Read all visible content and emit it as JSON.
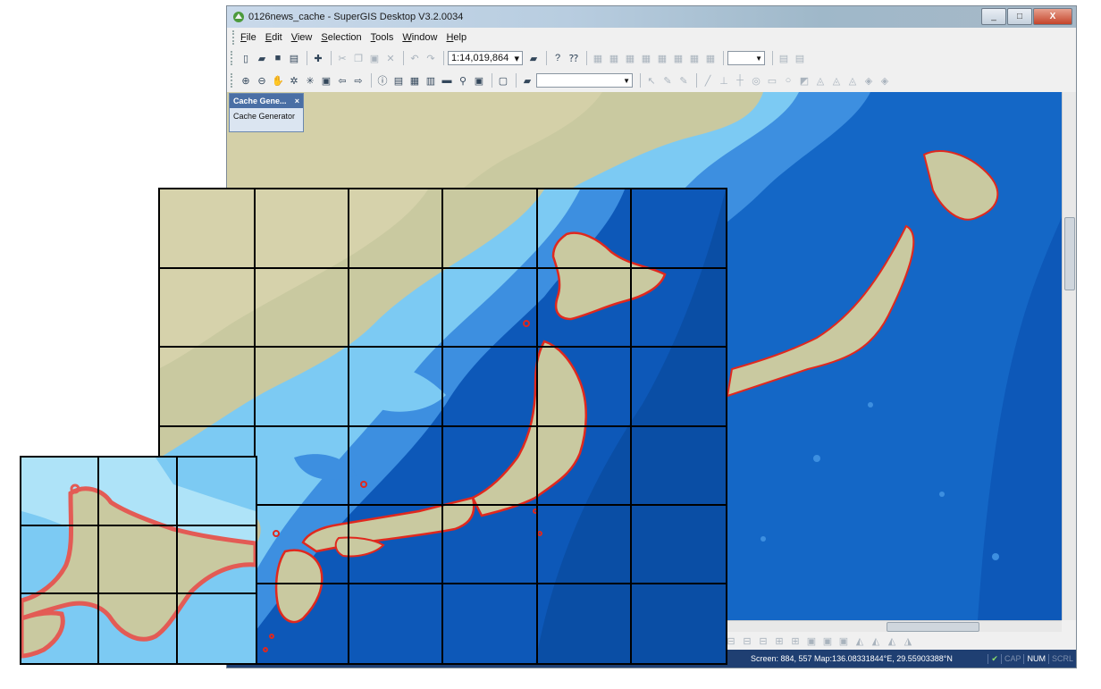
{
  "window": {
    "title": "0126news_cache - SuperGIS Desktop V3.2.0034",
    "controls": [
      "_",
      "□",
      "X"
    ]
  },
  "menu": [
    {
      "label": "File",
      "key": "F",
      "rest": "ile"
    },
    {
      "label": "Edit",
      "key": "E",
      "rest": "dit"
    },
    {
      "label": "View",
      "key": "V",
      "rest": "iew"
    },
    {
      "label": "Selection",
      "key": "S",
      "rest": "election"
    },
    {
      "label": "Tools",
      "key": "T",
      "rest": "ools"
    },
    {
      "label": "Window",
      "key": "W",
      "rest": "indow"
    },
    {
      "label": "Help",
      "key": "H",
      "rest": "elp"
    }
  ],
  "toolbar": {
    "scale": "1:14,019,864",
    "new_icon": "new-document-icon",
    "open_icon": "open-folder-icon",
    "save_icon": "save-icon",
    "print_icon": "print-icon"
  },
  "panel": {
    "tab_title": "Cache Gene...",
    "close": "×",
    "item": "Cache Generator"
  },
  "status": {
    "coords": "Screen: 884, 557  Map:136.08331844°E, 29.55903388°N",
    "keys": [
      "CAP",
      "NUM",
      "SCRL"
    ],
    "active_keys": [
      "NUM"
    ]
  },
  "colors": {
    "deep_ocean": "#0d58b8",
    "mid_ocean": "#3d8fe0",
    "shelf": "#7ccaf3",
    "shallow": "#aee3f8",
    "land": "#c9c9a0",
    "boundary": "#e0281e",
    "grid": "#000000"
  }
}
